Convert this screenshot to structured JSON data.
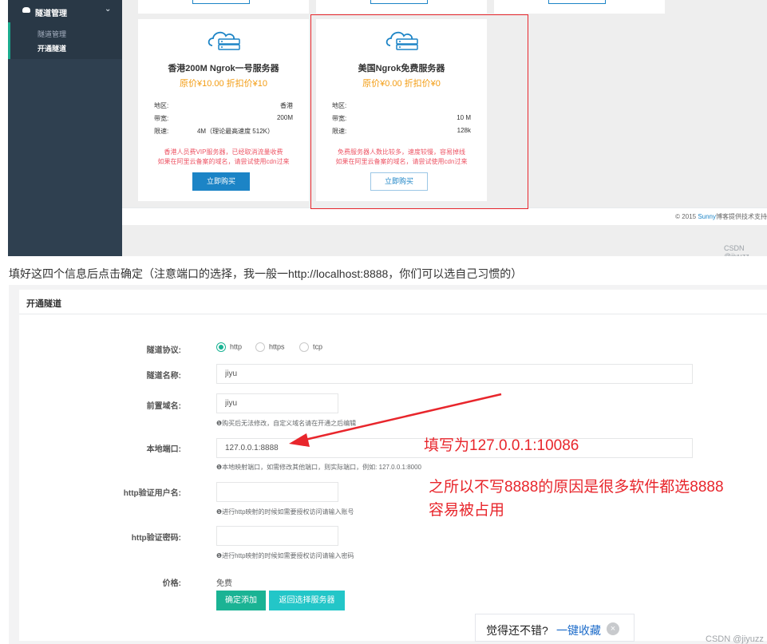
{
  "sidebar": {
    "group_label": "隧道管理",
    "items": [
      "隧道管理",
      "开通隧道"
    ]
  },
  "cards": [
    {
      "title": "香港200M Ngrok一号服务器",
      "price": "原价¥10.00   折扣价¥10",
      "rows": [
        {
          "k": "地区:",
          "v": "香港"
        },
        {
          "k": "带宽:",
          "v": "200M"
        },
        {
          "k": "限速:",
          "v": "4M（理论最高速度 512K）"
        }
      ],
      "note": [
        "香港人员费VIP服务器，已经取消流量收费",
        "如果在阿里云备案的域名，请尝试使用cdn过来"
      ],
      "buy": "立即购买"
    },
    {
      "title": "美国Ngrok免费服务器",
      "price": "原价¥0.00   折扣价¥0",
      "rows": [
        {
          "k": "地区:",
          "v": ""
        },
        {
          "k": "带宽:",
          "v": "10 M"
        },
        {
          "k": "限速:",
          "v": "128k"
        }
      ],
      "note": [
        "免费服务器人数比较多，速度较慢，容易掉线",
        "如果在阿里云备案的域名，请尝试使用cdn过来"
      ],
      "buy": "立即购买"
    }
  ],
  "footer1": {
    "prefix": "© 2015 ",
    "brand": "Sunny",
    "suffix": "博客提供技术支持"
  },
  "watermark": "CSDN @jiyuzz",
  "sentence": "填好这四个信息后点击确定（注意端口的选择，我一般一http://localhost:8888，你们可以选自己习惯的）",
  "form": {
    "panel_title": "开通隧道",
    "protocol": {
      "label": "隧道协议:",
      "options": [
        "http",
        "https",
        "tcp"
      ],
      "selected": "http"
    },
    "name": {
      "label": "隧道名称:",
      "value": "jiyu"
    },
    "domain": {
      "label": "前置域名:",
      "value": "jiyu",
      "help": "❶购买后无法修改，自定义域名请在开通之后编辑"
    },
    "port": {
      "label": "本地端口:",
      "value": "127.0.0.1:8888",
      "help": "❶本地映射端口，如需修改其他端口，则实际端口，例如:   127.0.0.1:8000"
    },
    "user": {
      "label": "http验证用户名:",
      "value": "",
      "help": "❶进行http映射的时候如需要授权访问请输入账号"
    },
    "pass": {
      "label": "http验证密码:",
      "value": "",
      "help": "❶进行http映射的时候如需要授权访问请输入密码"
    },
    "price": {
      "label": "价格:",
      "value": "免费"
    },
    "confirm_button": "确定添加",
    "back_button": "返回选择服务器"
  },
  "annotations": {
    "line1": "填写为127.0.0.1:10086",
    "line2": "之所以不写8888的原因是很多软件都选8888",
    "line3": "容易被占用"
  },
  "favorite": {
    "text": "觉得还不错?",
    "action": "一键收藏",
    "close": "×"
  },
  "colors": {
    "accent": "#1ab394",
    "link": "#1c84c6",
    "price": "#f39c12",
    "warning": "#ed5565",
    "annotation": "#e8262c"
  }
}
